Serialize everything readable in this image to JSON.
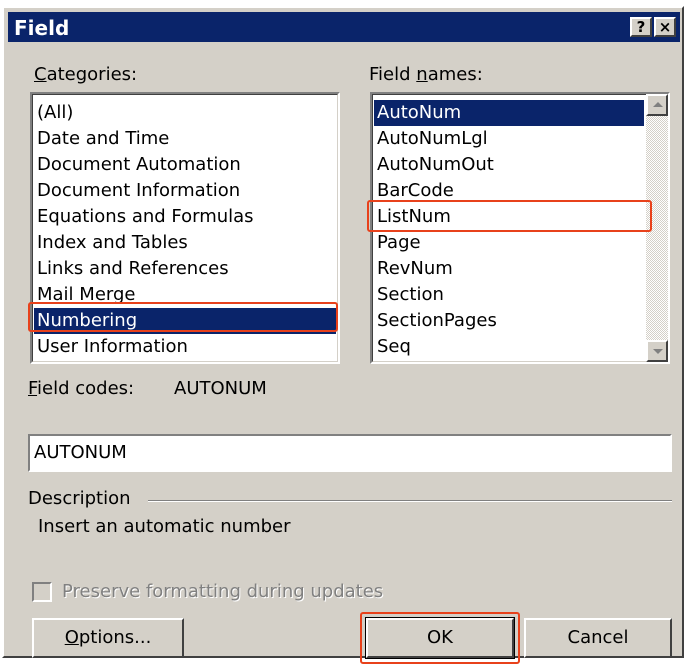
{
  "dialog": {
    "title": "Field",
    "help_button": "?",
    "close_button": "×"
  },
  "categories": {
    "label_mnemonic": "C",
    "label_rest": "ategories:",
    "items": [
      "(All)",
      "Date and Time",
      "Document Automation",
      "Document Information",
      "Equations and Formulas",
      "Index and Tables",
      "Links and References",
      "Mail Merge",
      "Numbering",
      "User Information"
    ],
    "selected": "Numbering"
  },
  "field_names": {
    "label_pre": "Field ",
    "label_mnemonic": "n",
    "label_rest": "ames:",
    "items": [
      "AutoNum",
      "AutoNumLgl",
      "AutoNumOut",
      "BarCode",
      "ListNum",
      "Page",
      "RevNum",
      "Section",
      "SectionPages",
      "Seq"
    ],
    "selected": "AutoNum",
    "highlighted": "ListNum"
  },
  "field_codes": {
    "label_mnemonic": "F",
    "label_rest": "ield codes:",
    "syntax": "AUTONUM",
    "value": "AUTONUM"
  },
  "description": {
    "label": "Description",
    "text": "Insert an automatic number"
  },
  "preserve_formatting": {
    "label": "Preserve formatting during updates",
    "checked": false,
    "enabled": false
  },
  "buttons": {
    "options_mnemonic": "O",
    "options_rest": "ptions...",
    "ok": "OK",
    "cancel": "Cancel"
  },
  "colors": {
    "face": "#d4d0c8",
    "selection": "#0a246a",
    "highlight_annotation": "#e8411b"
  }
}
